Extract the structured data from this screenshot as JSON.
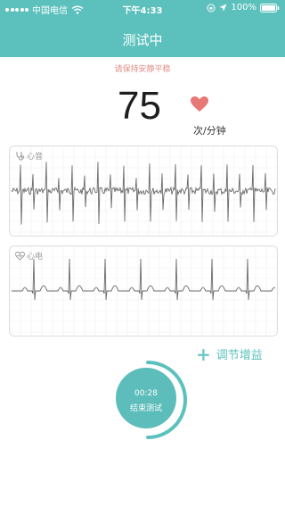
{
  "status_bar": {
    "carrier": "中国电信",
    "time": "下午4:33",
    "battery": "100%"
  },
  "header": {
    "title": "测试中"
  },
  "warning": "请保持安静平稳",
  "heart_rate": {
    "value": "75",
    "unit": "次/分钟"
  },
  "cards": [
    {
      "label": "心音",
      "icon": "stethoscope-icon"
    },
    {
      "label": "心电",
      "icon": "heart-outline-icon"
    }
  ],
  "gain_button": {
    "label": "调节增益",
    "icon": "plus-icon"
  },
  "test_control": {
    "time": "00:28",
    "label": "结束测试"
  },
  "colors": {
    "teal": "#5cc1bd",
    "warning": "#e48c86",
    "heart": "#e87876"
  }
}
